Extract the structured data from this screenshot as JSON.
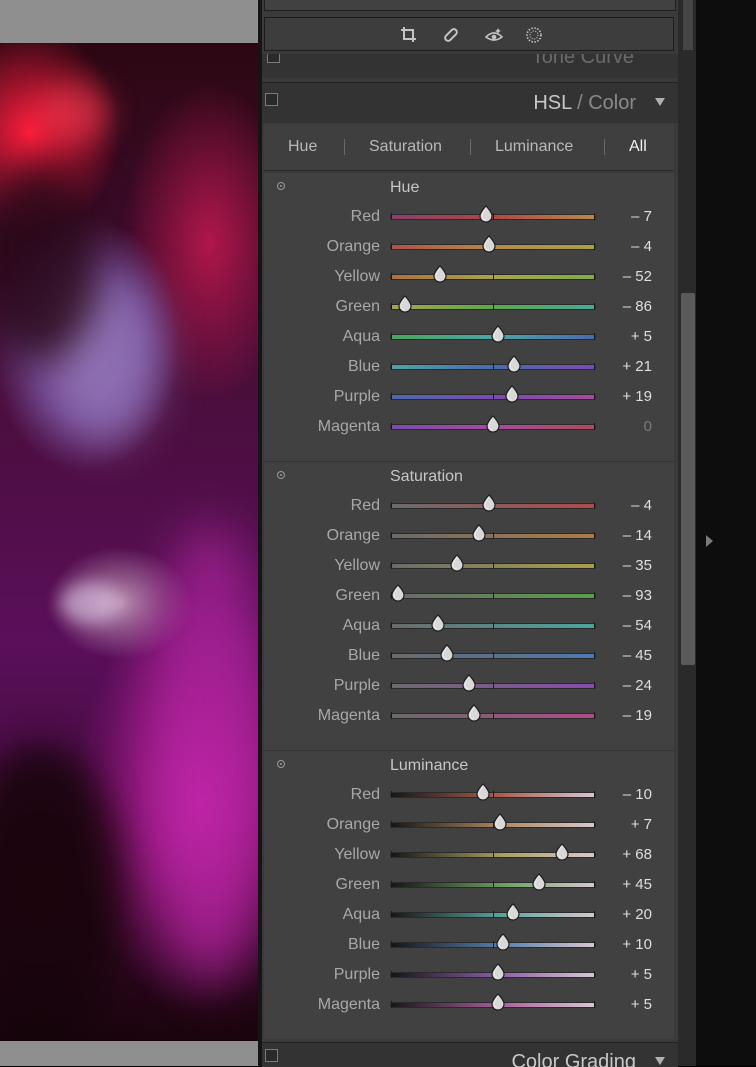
{
  "panel": {
    "tone_curve_label": "Tone Curve",
    "hsl_title_hsl": "HSL",
    "hsl_title_slash": " / ",
    "hsl_title_color": "Color",
    "color_grading_label": "Color Grading"
  },
  "tools": [
    "crop-icon",
    "healing-icon",
    "red-eye-icon",
    "masking-icon"
  ],
  "tabs": [
    {
      "label": "Hue",
      "active": false
    },
    {
      "label": "Saturation",
      "active": false
    },
    {
      "label": "Luminance",
      "active": false
    },
    {
      "label": "All",
      "active": true
    }
  ],
  "sections": [
    {
      "title": "Hue",
      "rows": [
        {
          "label": "Red",
          "value": "– 7",
          "num": -7
        },
        {
          "label": "Orange",
          "value": "– 4",
          "num": -4
        },
        {
          "label": "Yellow",
          "value": "– 52",
          "num": -52
        },
        {
          "label": "Green",
          "value": "– 86",
          "num": -86
        },
        {
          "label": "Aqua",
          "value": "+ 5",
          "num": 5
        },
        {
          "label": "Blue",
          "value": "+ 21",
          "num": 21
        },
        {
          "label": "Purple",
          "value": "+ 19",
          "num": 19
        },
        {
          "label": "Magenta",
          "value": "0",
          "num": 0
        }
      ]
    },
    {
      "title": "Saturation",
      "rows": [
        {
          "label": "Red",
          "value": "– 4",
          "num": -4
        },
        {
          "label": "Orange",
          "value": "– 14",
          "num": -14
        },
        {
          "label": "Yellow",
          "value": "– 35",
          "num": -35
        },
        {
          "label": "Green",
          "value": "– 93",
          "num": -93
        },
        {
          "label": "Aqua",
          "value": "– 54",
          "num": -54
        },
        {
          "label": "Blue",
          "value": "– 45",
          "num": -45
        },
        {
          "label": "Purple",
          "value": "– 24",
          "num": -24
        },
        {
          "label": "Magenta",
          "value": "– 19",
          "num": -19
        }
      ]
    },
    {
      "title": "Luminance",
      "rows": [
        {
          "label": "Red",
          "value": "– 10",
          "num": -10
        },
        {
          "label": "Orange",
          "value": "+ 7",
          "num": 7
        },
        {
          "label": "Yellow",
          "value": "+ 68",
          "num": 68
        },
        {
          "label": "Green",
          "value": "+ 45",
          "num": 45
        },
        {
          "label": "Aqua",
          "value": "+ 20",
          "num": 20
        },
        {
          "label": "Blue",
          "value": "+ 10",
          "num": 10
        },
        {
          "label": "Purple",
          "value": "+ 5",
          "num": 5
        },
        {
          "label": "Magenta",
          "value": "+ 5",
          "num": 5
        }
      ]
    }
  ],
  "colors": {
    "panel_bg": "#414141",
    "hue_gradients": [
      [
        "#8a3f6a",
        "#b24545",
        "#b58a4a"
      ],
      [
        "#b0504a",
        "#b58a4a",
        "#aaa04a"
      ],
      [
        "#b0703e",
        "#a9a34a",
        "#7cae4a"
      ],
      [
        "#a6a64a",
        "#5aa94a",
        "#4aa89a"
      ],
      [
        "#4aa65a",
        "#4aa6a8",
        "#4a6ab0"
      ],
      [
        "#4aa6a8",
        "#4a6ab0",
        "#7a4ab0"
      ],
      [
        "#4a6ab0",
        "#7a4ab0",
        "#a84aa0"
      ],
      [
        "#7a4ab0",
        "#a84aa0",
        "#b04a5a"
      ]
    ],
    "sat_colors": [
      "#b04a4a",
      "#b07a45",
      "#aaa04a",
      "#5aa04a",
      "#4aa6a0",
      "#4a7ab0",
      "#8a4ab0",
      "#b04a8a"
    ],
    "lum_colors": [
      "#b06050",
      "#b08a60",
      "#aaa060",
      "#6aa060",
      "#5aa6a0",
      "#5a80b0",
      "#9060b0",
      "#b060a0"
    ]
  }
}
